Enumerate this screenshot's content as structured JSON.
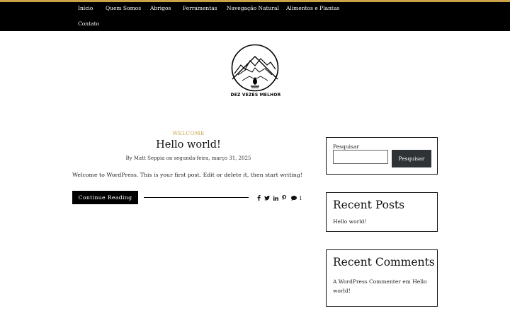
{
  "nav": {
    "items": [
      {
        "label": "Início"
      },
      {
        "label": "Quem Somos"
      },
      {
        "label": "Abrigos"
      },
      {
        "label": "Ferramentas"
      },
      {
        "label": "Navegação Natural"
      },
      {
        "label": "Alimentos e Plantas"
      },
      {
        "label": "Contato"
      }
    ]
  },
  "logo": {
    "text": "DEZ VEZES MELHOR"
  },
  "post": {
    "category": "WELCOME",
    "title": "Hello world!",
    "meta": "By Matt Seppia on segunda-feira, março 31, 2025",
    "excerpt": "Welcome to WordPress. This is your first post. Edit or delete it, then start writing!",
    "continue_label": "Continue Reading",
    "comment_count": "1",
    "share_icons": [
      "facebook-icon",
      "twitter-icon",
      "linkedin-icon",
      "pinterest-icon"
    ]
  },
  "sidebar": {
    "search": {
      "label": "Pesquisar",
      "value": "",
      "button": "Pesquisar"
    },
    "recent_posts": {
      "title": "Recent Posts",
      "items": [
        "Hello world!"
      ]
    },
    "recent_comments": {
      "title": "Recent Comments",
      "author": "A WordPress Commenter",
      "connector": "em",
      "post": "Hello world!"
    }
  },
  "colors": {
    "accent": "#c9a24a",
    "nav_bg": "#000000",
    "button_dark": "#2f3336"
  }
}
